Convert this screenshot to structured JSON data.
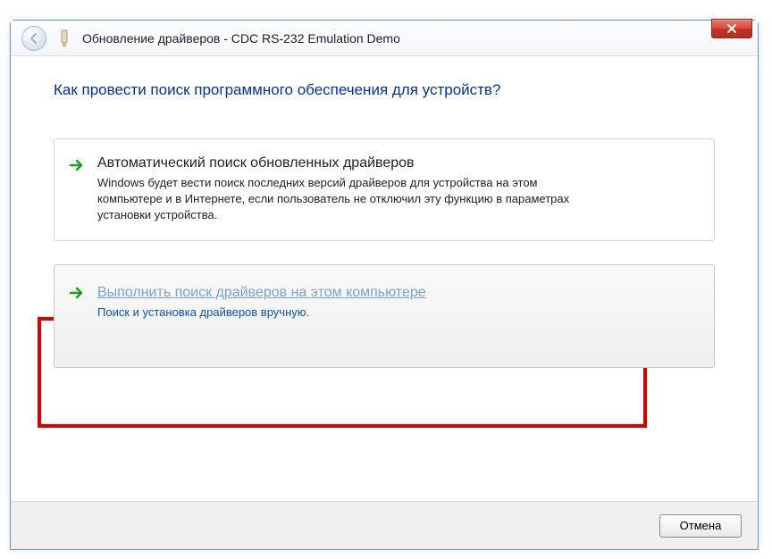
{
  "window": {
    "title": "Обновление драйверов - CDC RS-232 Emulation Demo"
  },
  "heading": "Как провести поиск программного обеспечения для устройств?",
  "options": [
    {
      "title": "Автоматический поиск обновленных драйверов",
      "description": "Windows будет вести поиск последних версий драйверов для устройства на этом компьютере и в Интернете, если пользователь не отключил эту функцию в параметрах установки устройства."
    },
    {
      "title": "Выполнить поиск драйверов на этом компьютере",
      "description": "Поиск и установка драйверов вручную."
    }
  ],
  "footer": {
    "cancel_label": "Отмена"
  }
}
